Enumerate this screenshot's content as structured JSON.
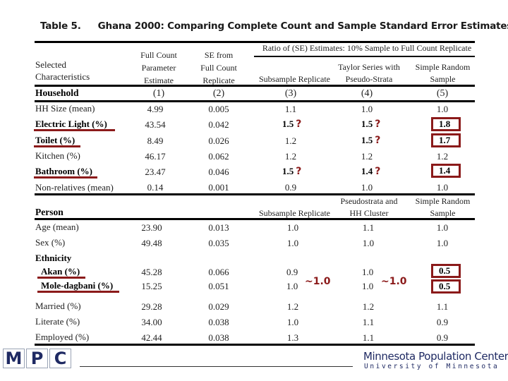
{
  "title": {
    "table_number": "Table 5.",
    "text": "Ghana 2000:  Comparing Complete Count and Sample Standard Error Estimates"
  },
  "header": {
    "selected": "Selected",
    "characteristics": "Characteristics",
    "col1": [
      "Full Count",
      "Parameter",
      "Estimate"
    ],
    "col2": [
      "SE from",
      "Full Count",
      "Replicate"
    ],
    "ratio_span": "Ratio of (SE) Estimates: 10% Sample to Full Count Replicate",
    "col3": "Subsample Replicate",
    "col4": [
      "Taylor Series with",
      "Pseudo-Strata"
    ],
    "col5": [
      "Simple Random",
      "Sample"
    ]
  },
  "household": {
    "section_label": "Household",
    "col_numbers": [
      "(1)",
      "(2)",
      "(3)",
      "(4)",
      "(5)"
    ],
    "rows": [
      {
        "label": "HH Size (mean)",
        "c1": "4.99",
        "c2": "0.005",
        "c3": "1.1",
        "c4": "1.0",
        "c5": "1.0"
      },
      {
        "label": "Electric Light (%)",
        "c1": "43.54",
        "c2": "0.042",
        "c3": "1.5",
        "c4": "1.5",
        "c5": "1.8"
      },
      {
        "label": "Toilet (%)",
        "c1": "8.49",
        "c2": "0.026",
        "c3": "1.2",
        "c4": "1.5",
        "c5": "1.7"
      },
      {
        "label": "Kitchen (%)",
        "c1": "46.17",
        "c2": "0.062",
        "c3": "1.2",
        "c4": "1.2",
        "c5": "1.2"
      },
      {
        "label": "Bathroom (%)",
        "c1": "23.47",
        "c2": "0.046",
        "c3": "1.5",
        "c4": "1.4",
        "c5": "1.4"
      },
      {
        "label": "Non-relatives (mean)",
        "c1": "0.14",
        "c2": "0.001",
        "c3": "0.9",
        "c4": "1.0",
        "c5": "1.0"
      }
    ],
    "question_mark": "?"
  },
  "person": {
    "section_label": "Person",
    "col3": "Subsample Replicate",
    "col4": [
      "Pseudostrata and",
      "HH Cluster"
    ],
    "col5": [
      "Simple Random",
      "Sample"
    ],
    "rows": [
      {
        "label": "Age (mean)",
        "c1": "23.90",
        "c2": "0.013",
        "c3": "1.0",
        "c4": "1.1",
        "c5": "1.0"
      },
      {
        "label": "Sex (%)",
        "c1": "49.48",
        "c2": "0.035",
        "c3": "1.0",
        "c4": "1.0",
        "c5": "1.0"
      }
    ],
    "ethnicity_label": "Ethnicity",
    "ethnicity_rows": [
      {
        "label": "Akan (%)",
        "c1": "45.28",
        "c2": "0.066",
        "c3": "0.9",
        "c4": "1.0",
        "c5": "0.5"
      },
      {
        "label": "Mole-dagbani (%)",
        "c1": "15.25",
        "c2": "0.051",
        "c3": "1.0",
        "c4": "1.0",
        "c5": "0.5"
      }
    ],
    "approx_c3": "~1.0",
    "approx_c4": "~1.0",
    "rows2": [
      {
        "label": "Married (%)",
        "c1": "29.28",
        "c2": "0.029",
        "c3": "1.2",
        "c4": "1.2",
        "c5": "1.1"
      },
      {
        "label": "Literate (%)",
        "c1": "34.00",
        "c2": "0.038",
        "c3": "1.0",
        "c4": "1.1",
        "c5": "0.9"
      },
      {
        "label": "Employed (%)",
        "c1": "42.44",
        "c2": "0.038",
        "c3": "1.3",
        "c4": "1.1",
        "c5": "0.9"
      }
    ]
  },
  "footer": {
    "logo_letters": [
      "M",
      "P",
      "C"
    ],
    "org_name": "Minnesota Population Center",
    "org_sub": "University of Minnesota"
  },
  "colors": {
    "highlight": "#8b1a1a",
    "logo_blue": "#1f2a63"
  }
}
